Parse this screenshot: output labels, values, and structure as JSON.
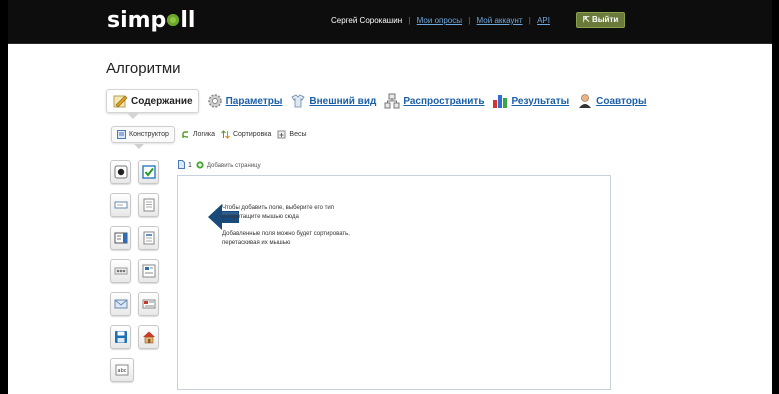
{
  "header": {
    "logo": "simpoll",
    "user": "Сергей Сорокашин",
    "links": [
      "Мои опросы",
      "Мой аккаунт",
      "API"
    ],
    "logout": "Выйти"
  },
  "page_title": "Алгоритми",
  "main_tabs": [
    {
      "label": "Содержание",
      "icon": "pencil-note-icon",
      "active": true
    },
    {
      "label": "Параметры",
      "icon": "gear-icon",
      "active": false
    },
    {
      "label": "Внешний вид",
      "icon": "tshirt-icon",
      "active": false
    },
    {
      "label": "Распространить",
      "icon": "network-icon",
      "active": false
    },
    {
      "label": "Результаты",
      "icon": "bar-chart-icon",
      "active": false
    },
    {
      "label": "Соавторы",
      "icon": "person-icon",
      "active": false
    }
  ],
  "sub_tabs": [
    {
      "label": "Конструктор",
      "icon": "form-icon",
      "active": true
    },
    {
      "label": "Логика",
      "icon": "branch-icon",
      "active": false
    },
    {
      "label": "Сортировка",
      "icon": "sort-icon",
      "active": false
    },
    {
      "label": "Весы",
      "icon": "scales-icon",
      "active": false
    }
  ],
  "palette": [
    "radio-field-icon",
    "checkbox-field-icon",
    "text-line-field-icon",
    "textarea-field-icon",
    "dropdown-field-icon",
    "list-field-icon",
    "rating-field-icon",
    "matrix-field-icon",
    "email-field-icon",
    "date-field-icon",
    "save-field-icon",
    "home-field-icon",
    "abc-text-field-icon"
  ],
  "page_bar": {
    "page_number": "1",
    "add_page": "Добавить страницу"
  },
  "canvas": {
    "hint_line1": "Чтобы добавить поле, выберите его тип",
    "hint_line2": "и перетащите мышью сюда",
    "hint_line3": "Добавленные поля можно будет сортировать,",
    "hint_line4": "перетаскивая их мышью"
  },
  "colors": {
    "header_bg": "#0d0d0d",
    "link": "#1b5fa8",
    "logo_dot": "#8cc63f",
    "arrow": "#1a4a7a"
  }
}
